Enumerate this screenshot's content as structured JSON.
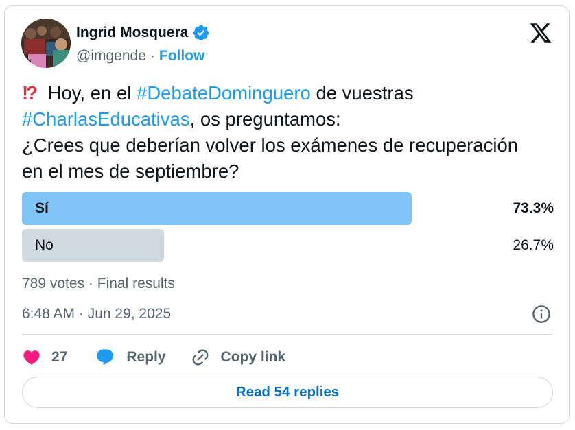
{
  "author": {
    "name": "Ingrid Mosquera",
    "handle": "@imgende",
    "separator": "·",
    "follow_label": "Follow",
    "avatar_icon": "profile-photo",
    "verified_icon": "verified-badge-icon",
    "verified_color": "#1d9bf0"
  },
  "platform": {
    "logo_icon": "x-logo-icon"
  },
  "tweet": {
    "emoji": "⁉️",
    "line1_a": " Hoy, en el ",
    "hashtag1": "#DebateDominguero",
    "line1_b": " de vuestras",
    "hashtag2": "#CharlasEducativas",
    "line2_b": ", os preguntamos:",
    "line3": "¿Crees que deberían volver los exámenes de recuperación",
    "line4": "en el mes de septiembre?"
  },
  "poll": {
    "options": [
      {
        "label": "Sí",
        "percent_label": "73.3%",
        "fraction": 0.733,
        "winner": true,
        "bar_color": "#7fc5f7"
      },
      {
        "label": "No",
        "percent_label": "26.7%",
        "fraction": 0.267,
        "winner": false,
        "bar_color": "#cfd9de"
      }
    ],
    "results_text": "789 votes · Final results"
  },
  "timestamp": "6:48 AM · Jun 29, 2025",
  "info_icon": "info-icon",
  "actions": {
    "like_icon": "heart-icon",
    "like_count": "27",
    "like_color": "#f91880",
    "reply_icon": "speech-bubble-icon",
    "reply_label": "Reply",
    "reply_color": "#1d9bf0",
    "copy_icon": "link-icon",
    "copy_label": "Copy link"
  },
  "read_replies_label": "Read 54 replies",
  "colors": {
    "accent": "#1d9bf0",
    "text": "#0f1419",
    "muted": "#536471",
    "border": "#cfd9de"
  }
}
